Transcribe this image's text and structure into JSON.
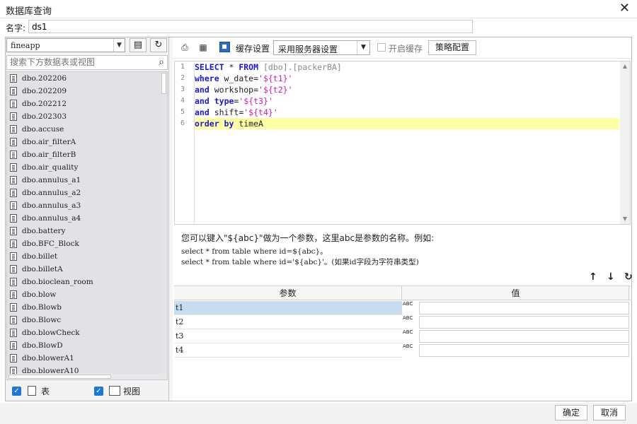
{
  "window": {
    "title": "数据库查询"
  },
  "name_field": {
    "label": "名字:",
    "value": "ds1"
  },
  "left": {
    "database": "fineapp",
    "search_placeholder": "搜索下方数据表或视图",
    "tables": [
      "dbo.202206",
      "dbo.202209",
      "dbo.202212",
      "dbo.202303",
      "dbo.accuse",
      "dbo.air_filterA",
      "dbo.air_filterB",
      "dbo.air_quality",
      "dbo.annulus_a1",
      "dbo.annulus_a2",
      "dbo.annulus_a3",
      "dbo.annulus_a4",
      "dbo.battery",
      "dbo.BFC_Block",
      "dbo.billet",
      "dbo.billetA",
      "dbo.bioclean_room",
      "dbo.blow",
      "dbo.Blowb",
      "dbo.Blowc",
      "dbo.blowCheck",
      "dbo.BlowD",
      "dbo.blowerA1",
      "dbo.blowerA10"
    ],
    "filter_table_label": "表",
    "filter_view_label": "视图"
  },
  "toolbar": {
    "cache_settings_label": "缓存设置",
    "server_setting_value": "采用服务器设置",
    "enable_cache_label": "开启缓存",
    "policy_button_label": "策略配置"
  },
  "editor": {
    "line_numbers": [
      "1",
      "2",
      "3",
      "4",
      "5",
      "6"
    ],
    "lines": [
      [
        [
          "kw",
          "SELECT"
        ],
        [
          "plain",
          " * "
        ],
        [
          "kw",
          "FROM"
        ],
        [
          "plain",
          " "
        ],
        [
          "gray",
          "[dbo].[packerBA]"
        ]
      ],
      [
        [
          "kw",
          "where"
        ],
        [
          "plain",
          " w_date="
        ],
        [
          "str",
          "'${t1}'"
        ]
      ],
      [
        [
          "kw",
          "and"
        ],
        [
          "plain",
          " workshop="
        ],
        [
          "str",
          "'${t2}'"
        ]
      ],
      [
        [
          "kw",
          "and"
        ],
        [
          "plain",
          " "
        ],
        [
          "kw",
          "type"
        ],
        [
          "plain",
          "="
        ],
        [
          "str",
          "'${t3}'"
        ]
      ],
      [
        [
          "kw",
          "and"
        ],
        [
          "plain",
          " shift="
        ],
        [
          "str",
          "'${t4}'"
        ]
      ],
      [
        [
          "kw",
          "order by"
        ],
        [
          "plain",
          " timeA"
        ]
      ]
    ]
  },
  "hint": {
    "line1": "您可以键入\"${abc}\"做为一个参数，这里abc是参数的名称。例如:",
    "line2": "select * from table where id=${abc}。",
    "line3": "select * from table where id='${abc}'。(如果id字段为字符串类型)"
  },
  "params": {
    "col_name": "参数",
    "col_value": "值",
    "type_label": "ABC",
    "rows": [
      {
        "name": "t1",
        "value": ""
      },
      {
        "name": "t2",
        "value": ""
      },
      {
        "name": "t3",
        "value": ""
      },
      {
        "name": "t4",
        "value": ""
      }
    ]
  },
  "footer": {
    "ok_label": "确定",
    "cancel_label": "取消"
  }
}
